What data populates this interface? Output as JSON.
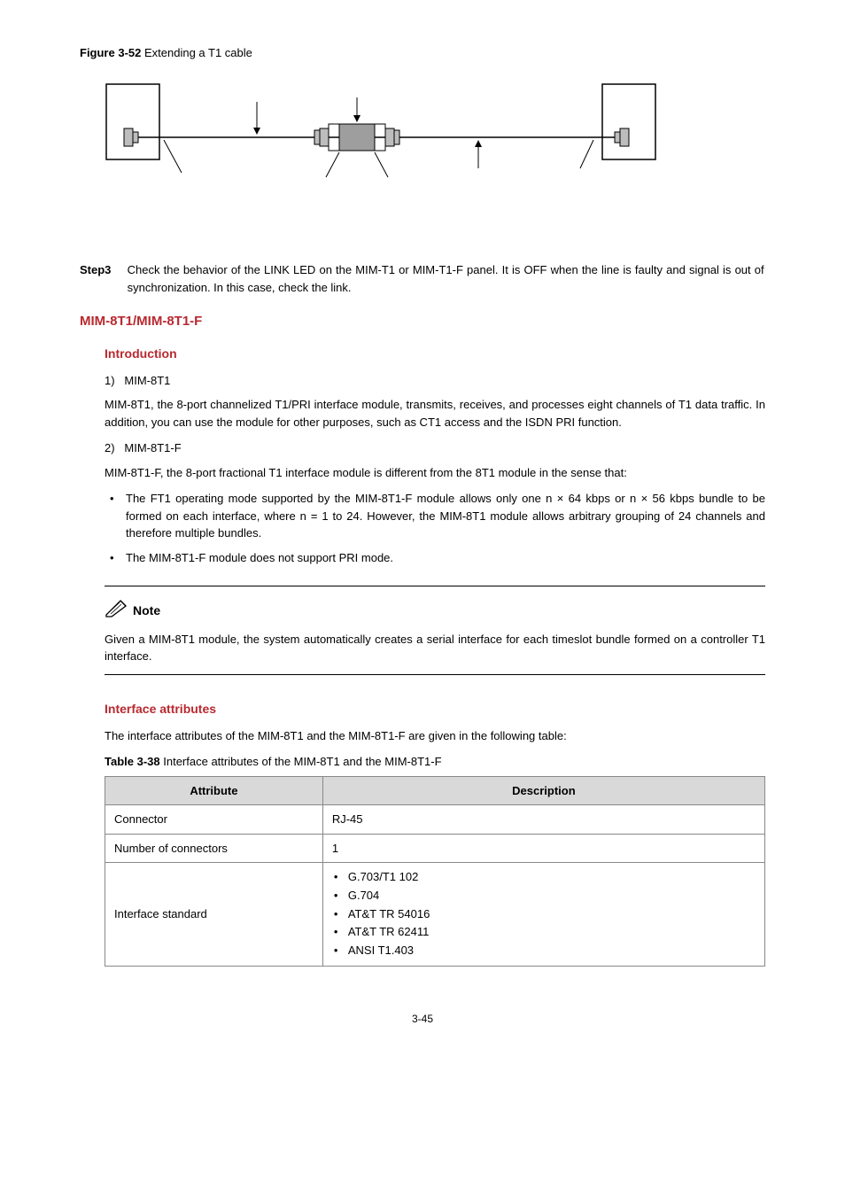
{
  "figure": {
    "label": "Figure 3-52",
    "caption": "Extending a T1 cable"
  },
  "step": {
    "label": "Step3",
    "text": "Check the behavior of the LINK LED on the MIM-T1 or MIM-T1-F panel. It is OFF when the line is faulty and signal is out of synchronization. In this case, check the link."
  },
  "section_title": "MIM-8T1/MIM-8T1-F",
  "intro": {
    "heading": "Introduction",
    "item1_num": "1)",
    "item1_label": "MIM-8T1",
    "item1_para": "MIM-8T1, the 8-port channelized T1/PRI interface module, transmits, receives, and processes eight channels of T1 data traffic. In addition, you can use the module for other purposes, such as CT1 access and the ISDN PRI function.",
    "item2_num": "2)",
    "item2_label": "MIM-8T1-F",
    "item2_para": "MIM-8T1-F, the 8-port fractional T1 interface module is different from the 8T1 module in the sense that:",
    "bullets": [
      "The FT1 operating mode supported by the MIM-8T1-F module allows only one n × 64 kbps or n × 56 kbps bundle to be formed on each interface, where n = 1 to 24. However, the MIM-8T1 module allows arbitrary grouping of 24 channels and therefore multiple bundles.",
      "The MIM-8T1-F module does not support PRI mode."
    ]
  },
  "note": {
    "label": "Note",
    "text": "Given a MIM-8T1 module, the system automatically creates a serial interface for each timeslot bundle formed on a controller T1 interface."
  },
  "attributes": {
    "heading": "Interface attributes",
    "intro": "The interface attributes of the MIM-8T1 and the MIM-8T1-F are given in the following table:",
    "table_caption_label": "Table 3-38",
    "table_caption_text": "Interface attributes of the MIM-8T1 and the MIM-8T1-F",
    "headers": {
      "attr": "Attribute",
      "desc": "Description"
    },
    "rows": {
      "connector": {
        "attr": "Connector",
        "desc": "RJ-45"
      },
      "num_connectors": {
        "attr": "Number of connectors",
        "desc": "1"
      },
      "standard": {
        "attr": "Interface standard",
        "items": [
          "G.703/T1 102",
          "G.704",
          "AT&T TR 54016",
          "AT&T TR 62411",
          "ANSI T1.403"
        ]
      }
    }
  },
  "page_number": "3-45"
}
